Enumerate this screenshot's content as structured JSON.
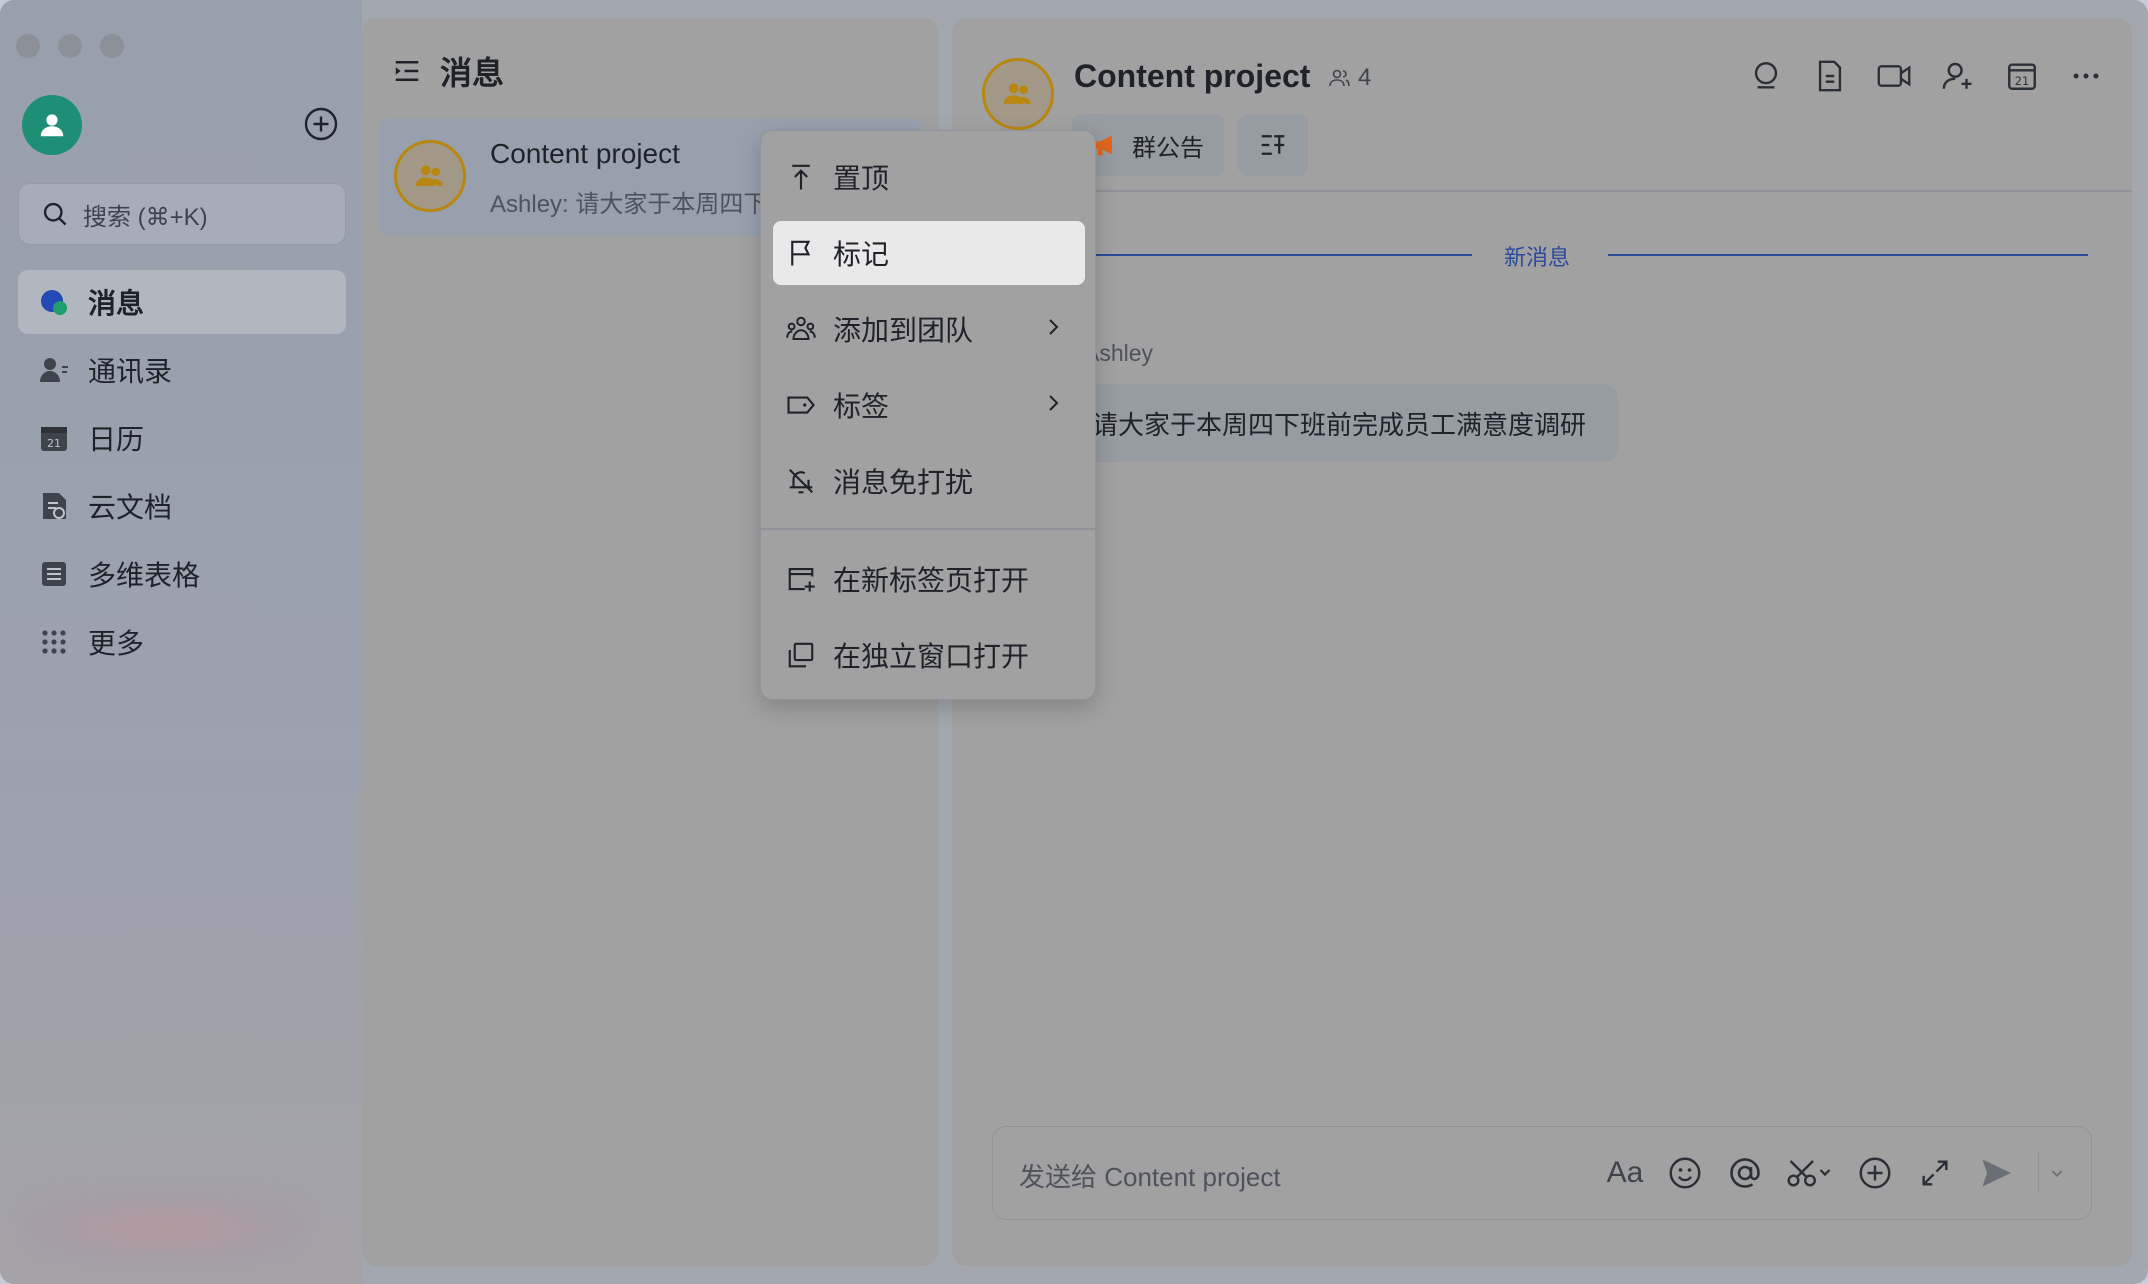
{
  "sidebar": {
    "search_placeholder": "搜索 (⌘+K)",
    "items": [
      {
        "label": "消息",
        "icon": "message-bubble-icon",
        "active": true
      },
      {
        "label": "通讯录",
        "icon": "contacts-icon"
      },
      {
        "label": "日历",
        "icon": "calendar-icon"
      },
      {
        "label": "云文档",
        "icon": "cloud-docs-icon"
      },
      {
        "label": "多维表格",
        "icon": "base-table-icon"
      },
      {
        "label": "更多",
        "icon": "grid-dots-icon"
      }
    ],
    "calendar_icon_day": "21"
  },
  "list": {
    "header": "消息",
    "chat": {
      "title": "Content project",
      "preview": "Ashley: 请大家于本周四下班前完成员工满意度调研"
    }
  },
  "chat": {
    "name": "Content project",
    "member_count": "4",
    "tabs": {
      "announcement": "群公告"
    },
    "calendar_icon_day": "21",
    "new_messages_label": "新消息",
    "sender": "Ashley",
    "message": "请大家于本周四下班前完成员工满意度调研",
    "composer_placeholder": "发送给 Content project",
    "format_label": "Aa"
  },
  "context_menu": {
    "items": [
      {
        "label": "置顶",
        "icon": "pin-top-icon"
      },
      {
        "label": "标记",
        "icon": "flag-icon",
        "highlighted": true
      },
      {
        "label": "添加到团队",
        "icon": "team-icon",
        "submenu": true
      },
      {
        "label": "标签",
        "icon": "tag-icon",
        "submenu": true
      },
      {
        "label": "消息免打扰",
        "icon": "bell-off-icon"
      },
      {
        "label": "在新标签页打开",
        "icon": "new-tab-icon"
      },
      {
        "label": "在独立窗口打开",
        "icon": "new-window-icon"
      }
    ]
  },
  "colors": {
    "accent_blue": "#2a4a9c",
    "avatar_green": "#1e8e74",
    "group_ring": "#b7870f",
    "megaphone": "#e0661c"
  }
}
